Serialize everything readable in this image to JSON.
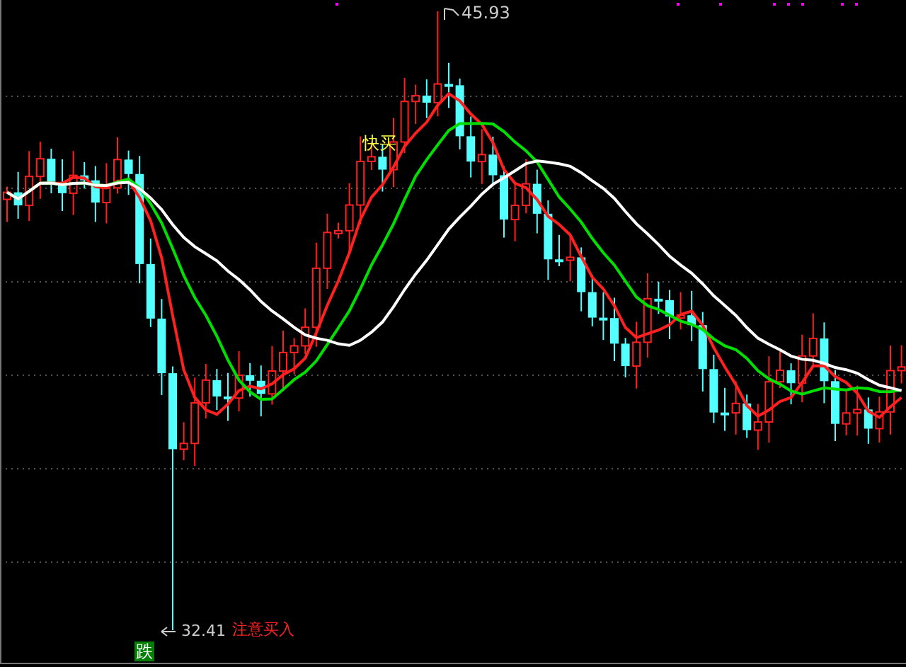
{
  "chart": {
    "high_label": "45.93",
    "low_label": "32.41",
    "signals": [
      {
        "kind": "buy",
        "text": "快买"
      },
      {
        "kind": "attention",
        "text": "注意买入"
      },
      {
        "kind": "fall",
        "text": "跌"
      }
    ]
  }
}
